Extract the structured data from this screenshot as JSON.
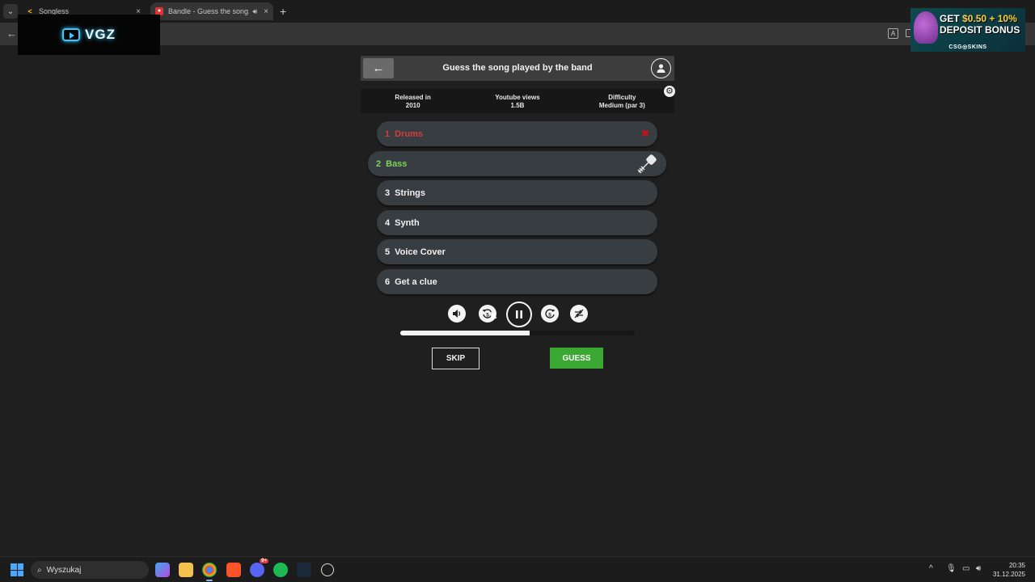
{
  "browser": {
    "tabs": [
      {
        "title": "Songless"
      },
      {
        "title": "Bandle - Guess the song, o"
      }
    ],
    "new_tab": "+",
    "close_glyph": "×"
  },
  "overlay": {
    "vgz_text": "VGZ"
  },
  "ad": {
    "line1_prefix": "GET ",
    "line1_highlight": "$0.50 + 10%",
    "line2": "DEPOSIT BONUS",
    "brand": "CSG◎SKINS"
  },
  "game": {
    "header_title": "Guess the song played by the band",
    "info": [
      {
        "label": "Released in",
        "value": "2010"
      },
      {
        "label": "Youtube views",
        "value": "1.5B"
      },
      {
        "label": "Difficulty",
        "value": "Medium (par 3)"
      }
    ],
    "tracks": [
      {
        "num": "1",
        "label": "Drums",
        "state": "failed"
      },
      {
        "num": "2",
        "label": "Bass",
        "state": "active"
      },
      {
        "num": "3",
        "label": "Strings",
        "state": "locked"
      },
      {
        "num": "4",
        "label": "Synth",
        "state": "locked"
      },
      {
        "num": "5",
        "label": "Voice Cover",
        "state": "locked"
      },
      {
        "num": "6",
        "label": "Get a clue",
        "state": "locked"
      }
    ],
    "fail_mark": "✖",
    "progress_fraction": 0.55,
    "skip_label": "SKIP",
    "guess_label": "GUESS",
    "rewind_seconds": "5",
    "forward_seconds": "5"
  },
  "colors": {
    "failed": "#d93b3b",
    "active": "#7bd35a",
    "guess": "#3aa832"
  },
  "taskbar": {
    "search_placeholder": "Wyszukaj",
    "time": "20:35",
    "date": "31.12.2025",
    "discord_badge": "9+"
  }
}
